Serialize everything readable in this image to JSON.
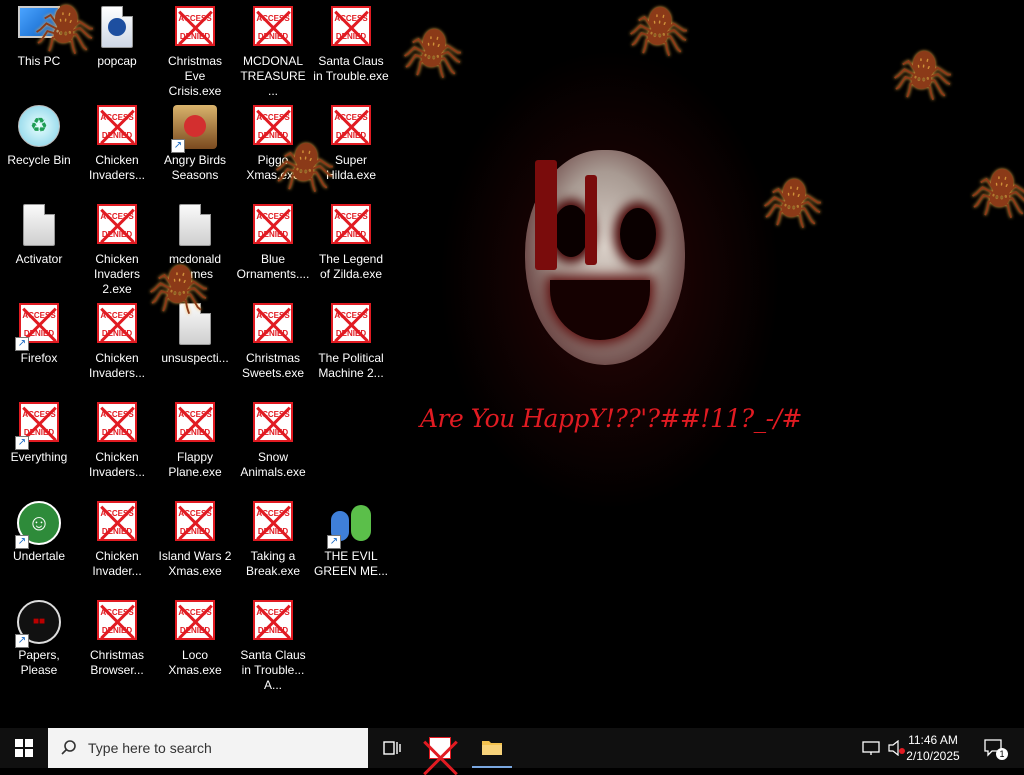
{
  "desktop": {
    "wallpaper_text": "Are You HappY!??'?##!11?_-/#",
    "icons": [
      {
        "label": "This PC"
      },
      {
        "label": "Recycle Bin"
      },
      {
        "label": "Activator"
      },
      {
        "label": "Firefox"
      },
      {
        "label": "Everything"
      },
      {
        "label": "Undertale"
      },
      {
        "label": "Papers, Please"
      },
      {
        "label": "popcap"
      },
      {
        "label": "Chicken Invaders..."
      },
      {
        "label": "Chicken Invaders 2.exe"
      },
      {
        "label": "Chicken Invaders..."
      },
      {
        "label": "Chicken Invaders..."
      },
      {
        "label": "Chicken Invader..."
      },
      {
        "label": "Christmas Browser..."
      },
      {
        "label": "Christmas Eve Crisis.exe"
      },
      {
        "label": "Angry Birds Seasons"
      },
      {
        "label": "mcdonald games"
      },
      {
        "label": "unsuspecti..."
      },
      {
        "label": "Flappy Plane.exe"
      },
      {
        "label": "Island Wars 2 Xmas.exe"
      },
      {
        "label": "Loco Xmas.exe"
      },
      {
        "label": "MCDONAL TREASURE ..."
      },
      {
        "label": "Piggo Xmas.exe"
      },
      {
        "label": "Blue Ornaments...."
      },
      {
        "label": "Christmas Sweets.exe"
      },
      {
        "label": "Snow Animals.exe"
      },
      {
        "label": "Taking a Break.exe"
      },
      {
        "label": "Santa Claus in Trouble... A..."
      },
      {
        "label": "Santa Claus in Trouble.exe"
      },
      {
        "label": "Super Hilda.exe"
      },
      {
        "label": "The Legend of Zilda.exe"
      },
      {
        "label": "The Political Machine 2..."
      },
      {
        "label": "THE EVIL GREEN ME..."
      }
    ],
    "access_denied_text": "ACCESS DENIED"
  },
  "taskbar": {
    "search_placeholder": "Type here to search",
    "time": "11:46 AM",
    "date": "2/10/2025",
    "notification_count": "1"
  },
  "colors": {
    "accent_red": "#e11b22",
    "taskbar": "#101010"
  }
}
